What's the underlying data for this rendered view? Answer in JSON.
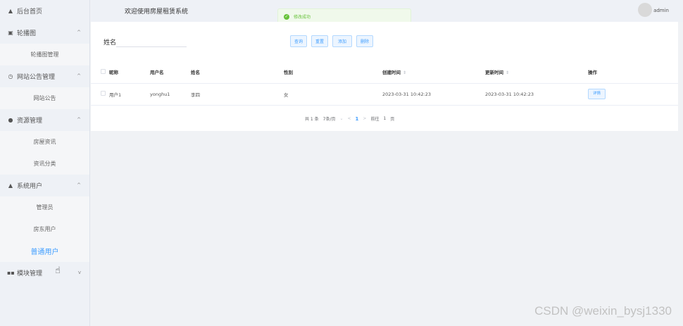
{
  "header": {
    "title": "欢迎使用房屋租赁系统",
    "user": "admin"
  },
  "toast": {
    "message": "修改成功"
  },
  "sidebar": {
    "home": "后台首页",
    "groups": [
      {
        "label": "轮播图",
        "icon": "image-icon",
        "chevron": "^",
        "items": [
          "轮播图管理"
        ]
      },
      {
        "label": "网站公告管理",
        "icon": "clock-icon",
        "chevron": "^",
        "items": [
          "网站公告"
        ]
      },
      {
        "label": "资源管理",
        "icon": "dot-icon",
        "chevron": "^",
        "items": [
          "房屋资讯",
          "资讯分类"
        ]
      },
      {
        "label": "系统用户",
        "icon": "user-icon",
        "chevron": "^",
        "items": [
          "管理员",
          "房东用户",
          "普通用户"
        ]
      },
      {
        "label": "模块管理",
        "icon": "grid-icon",
        "chevron": "v",
        "items": []
      }
    ],
    "active_item": "普通用户"
  },
  "search": {
    "label": "姓名",
    "value": "",
    "buttons": {
      "query": "查询",
      "reset": "重置",
      "add": "添加",
      "delete": "删除"
    }
  },
  "table": {
    "headers": [
      "昵称",
      "用户名",
      "姓名",
      "性别",
      "创建时间",
      "更新时间",
      "操作"
    ],
    "rows": [
      {
        "nickname": "用户1",
        "username": "yonghu1",
        "name": "李四",
        "gender": "女",
        "created": "2023-03-31 10:42:23",
        "updated": "2023-03-31 10:42:23",
        "action": "详情"
      }
    ]
  },
  "pager": {
    "total": "共 1 条",
    "page_size": "7条/页",
    "size_chevron": "⌄",
    "prev": "<",
    "current": "1",
    "next": ">",
    "goto": "前往",
    "goto_value": "1",
    "page_unit": "页"
  },
  "watermark": "CSDN @weixin_bysj1330"
}
